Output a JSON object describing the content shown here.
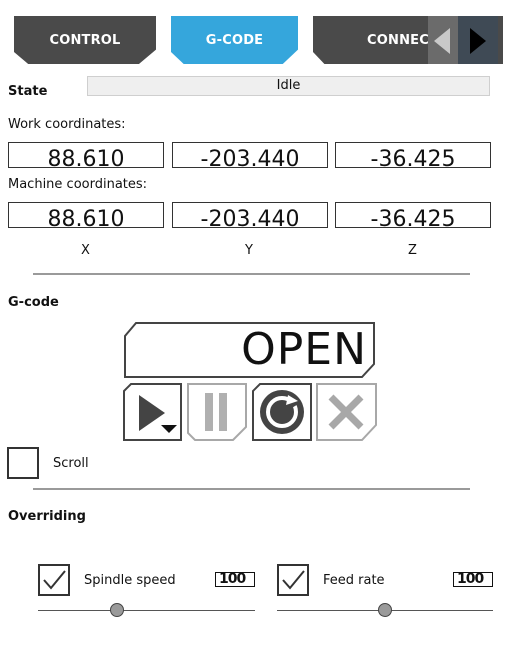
{
  "tabs": {
    "control": "CONTROL",
    "gcode": "G-CODE",
    "connection": "CONNECTION"
  },
  "state": {
    "label": "State",
    "value": "Idle"
  },
  "work": {
    "label": "Work coordinates:",
    "x": "88.610",
    "y": "-203.440",
    "z": "-36.425"
  },
  "machine": {
    "label": "Machine coordinates:",
    "x": "88.610",
    "y": "-203.440",
    "z": "-36.425"
  },
  "axes": {
    "x": "X",
    "y": "Y",
    "z": "Z"
  },
  "gcode": {
    "label": "G-code",
    "open_label": "OPEN",
    "scroll_label": "Scroll",
    "icons": [
      "play-icon",
      "pause-icon",
      "reset-icon",
      "stop-icon"
    ]
  },
  "overriding": {
    "label": "Overriding",
    "spindle": {
      "label": "Spindle speed",
      "value": "100",
      "checked": true,
      "level": 0.36
    },
    "feed": {
      "label": "Feed rate",
      "value": "100",
      "checked": true,
      "level": 0.5
    }
  },
  "colors": {
    "accent": "#35a6dc",
    "tab_dark": "#4a4a4a"
  }
}
